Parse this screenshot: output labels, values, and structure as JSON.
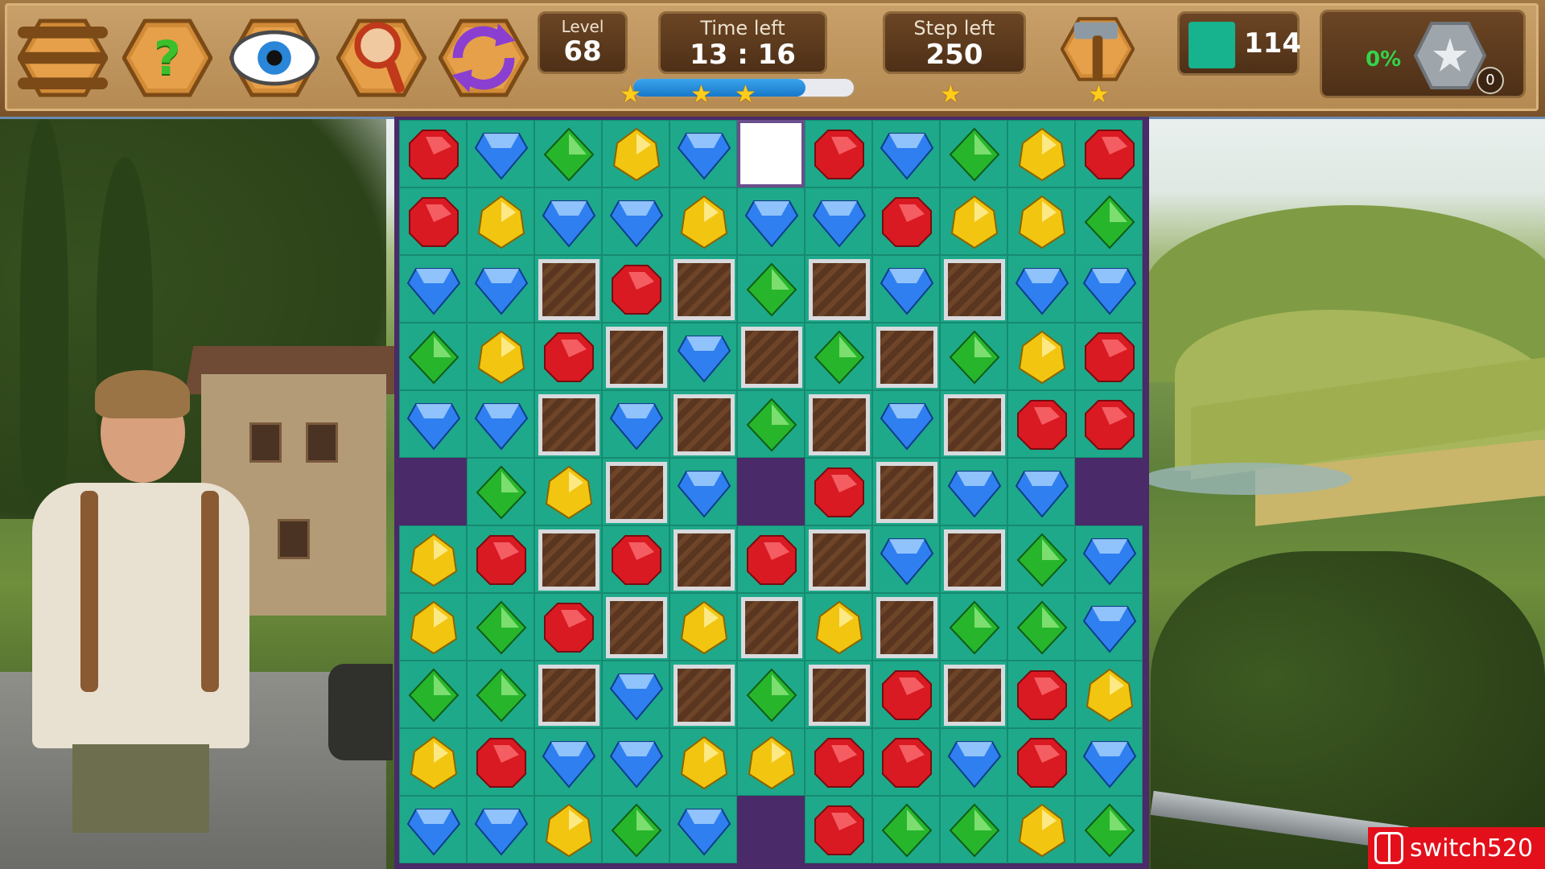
{
  "hud": {
    "buttons": [
      {
        "name": "menu-button",
        "icon": "hamburger-menu-icon"
      },
      {
        "name": "help-button",
        "icon": "question-mark-icon",
        "glyph": "?"
      },
      {
        "name": "hint-eye-button",
        "icon": "eye-icon"
      },
      {
        "name": "magnifier-button",
        "icon": "magnifying-glass-icon"
      },
      {
        "name": "shuffle-button",
        "icon": "refresh-arrows-icon"
      }
    ],
    "level_label": "Level",
    "level_value": "68",
    "time_label": "Time left",
    "time_value": "13 : 16",
    "steps_label": "Step left",
    "steps_value": "250",
    "progress_fraction": 0.78,
    "stars_count": 5,
    "hammer_icon": "hammer-icon",
    "goal_color": "#17b28e",
    "goal_value": "114",
    "bonus_percent": "0%",
    "bonus_count": "0",
    "bonus_icon": "star-bomb-icon"
  },
  "board": {
    "rows": [
      "RBGYBERBGYR",
      "RYBBYBBRYYG",
      "BBCRCGCBCBB",
      "GYRCBCGCGYR",
      "BBCBCGCBCRR",
      "HGYCBHRCBBH",
      "YRCRCRCBCGB",
      "YGRCYCYCGGB",
      "GGCBCGCRCRY",
      "YRBBYYRRBRB",
      "BBYGBHRGGYG"
    ],
    "legend": {
      "R": "red-gem",
      "B": "blue-gem",
      "G": "green-gem",
      "Y": "yellow-gem",
      "C": "wooden-crate",
      "H": "hole",
      "E": "empty-cell"
    }
  },
  "colors": {
    "red": "#d91a22",
    "blue": "#2f7ff0",
    "green": "#27b52c",
    "yellow": "#f2c511",
    "tile": "#1ea98a"
  },
  "watermark": {
    "text": "switch520"
  }
}
